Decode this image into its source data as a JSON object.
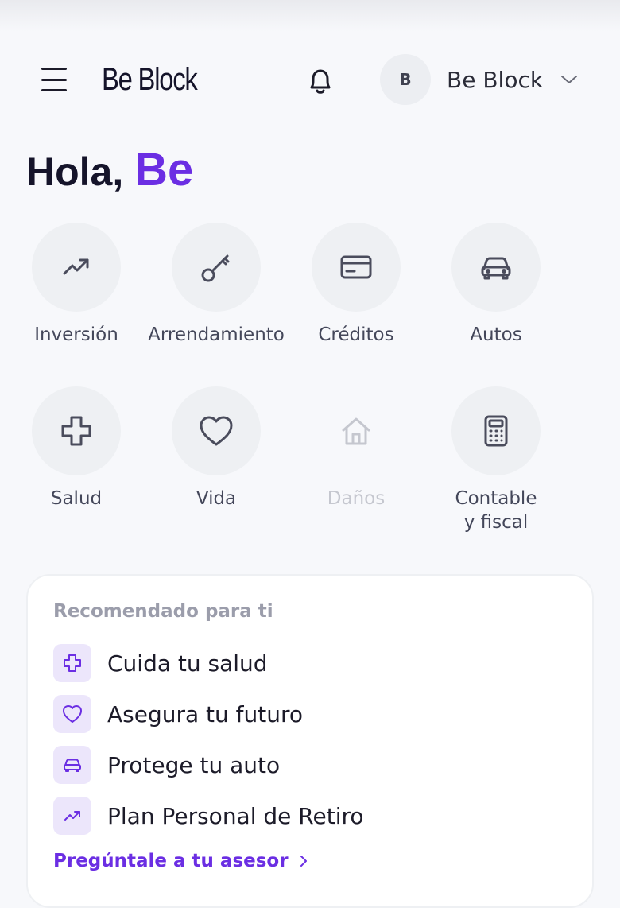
{
  "header": {
    "app_title": "Be Block",
    "avatar_initial": "B",
    "user_name": "Be Block"
  },
  "greeting": {
    "prefix": "Hola,",
    "name": "Be"
  },
  "services": [
    {
      "label": "Inversión",
      "icon": "trending-up-icon",
      "enabled": true
    },
    {
      "label": "Arrendamiento",
      "icon": "key-icon",
      "enabled": true
    },
    {
      "label": "Créditos",
      "icon": "credit-card-icon",
      "enabled": true
    },
    {
      "label": "Autos",
      "icon": "car-icon",
      "enabled": true
    },
    {
      "label": "Salud",
      "icon": "health-cross-icon",
      "enabled": true
    },
    {
      "label": "Vida",
      "icon": "heart-icon",
      "enabled": true
    },
    {
      "label": "Daños",
      "icon": "house-icon",
      "enabled": false
    },
    {
      "label_line1": "Contable",
      "label_line2": "y fiscal",
      "icon": "calculator-icon",
      "enabled": true
    }
  ],
  "recommended": {
    "title": "Recomendado para ti",
    "items": [
      {
        "label": "Cuida tu salud",
        "icon": "health-cross-icon"
      },
      {
        "label": "Asegura tu futuro",
        "icon": "heart-icon"
      },
      {
        "label": "Protege tu auto",
        "icon": "car-icon"
      },
      {
        "label": "Plan Personal de Retiro",
        "icon": "trending-up-icon"
      }
    ],
    "link": "Pregúntale a tu asesor"
  },
  "colors": {
    "accent": "#6b2ee3",
    "icon_gray": "#4a4c5c",
    "disabled": "#c5c7cf",
    "tile_bg": "#eef0f3",
    "rec_icon_bg": "#ece6fb"
  }
}
